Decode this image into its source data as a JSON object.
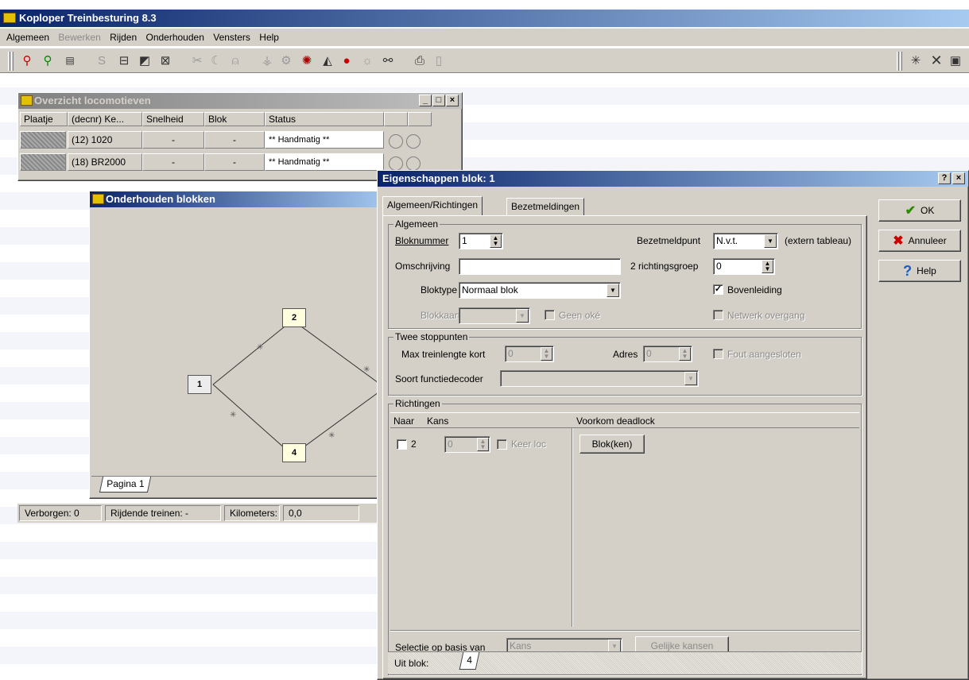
{
  "app": {
    "title": "Koploper Treinbesturing 8.3"
  },
  "menu": [
    {
      "label": "Algemeen",
      "disabled": false
    },
    {
      "label": "Bewerken",
      "disabled": true
    },
    {
      "label": "Rijden",
      "disabled": false
    },
    {
      "label": "Onderhouden",
      "disabled": false
    },
    {
      "label": "Vensters",
      "disabled": false
    },
    {
      "label": "Help",
      "disabled": false
    }
  ],
  "toolbar": {
    "icons": [
      "signal-red-icon",
      "signal-green-icon",
      "terminal-icon",
      "s-icon",
      "block-icon",
      "edit-block-icon",
      "delete-block-icon",
      "tools-icon",
      "curve-icon",
      "bell-icon",
      "switch-icon",
      "decoder-icon",
      "sound-icon",
      "locomotive-icon",
      "stop-icon",
      "light-icon",
      "track-icon",
      "print-icon",
      "page-icon"
    ],
    "right_icons": [
      "new-icon",
      "close-icon",
      "save-icon"
    ]
  },
  "loco_window": {
    "title": "Overzicht locomotieven",
    "columns": [
      "Plaatje",
      "(decnr) Ke...",
      "Snelheid",
      "Blok",
      "Status"
    ],
    "rows": [
      {
        "name": "(12) 1020",
        "speed": "-",
        "block": "-",
        "status": "** Handmatig **"
      },
      {
        "name": "(18) BR2000",
        "speed": "-",
        "block": "-",
        "status": "** Handmatig **"
      }
    ]
  },
  "blocks_window": {
    "title": "Onderhouden blokken",
    "page_tab": "Pagina 1",
    "blocks": [
      "1",
      "2",
      "4"
    ]
  },
  "statusbar": {
    "hidden": "Verborgen: 0",
    "driving": "Rijdende treinen: -",
    "km_label": "Kilometers:",
    "km_value": "0,0"
  },
  "dialog": {
    "title": "Eigenschappen blok: 1",
    "help_glyph": "?",
    "close_glyph": "×",
    "tabs": [
      "Algemeen/Richtingen",
      "Bezetmeldingen"
    ],
    "buttons": {
      "ok": "OK",
      "cancel": "Annuleer",
      "help": "Help"
    },
    "algemeen": {
      "group": "Algemeen",
      "bloknummer_label": "Bloknummer",
      "bloknummer_value": "1",
      "bezetmeldpunt_label": "Bezetmeldpunt",
      "bezetmeldpunt_value": "N.v.t.",
      "extern_label": "(extern tableau)",
      "omschrijving_label": "Omschrijving",
      "omschrijving_value": "",
      "richtingsgroep_label": "2 richtingsgroep",
      "richtingsgroep_value": "0",
      "bloktype_label": "Bloktype",
      "bloktype_value": "Normaal blok",
      "bovenleiding_label": "Bovenleiding",
      "bovenleiding_checked": true,
      "blokkaart_label": "Blokkaart",
      "geen_oke_label": "Geen oké",
      "netwerk_label": "Netwerk overgang"
    },
    "stoppunten": {
      "group": "Twee stoppunten",
      "max_label": "Max treinlengte kort",
      "max_value": "0",
      "adres_label": "Adres",
      "adres_value": "0",
      "fout_label": "Fout aangesloten",
      "decoder_label": "Soort functiedecoder",
      "decoder_value": ""
    },
    "richtingen": {
      "group": "Richtingen",
      "columns": [
        "Naar",
        "Kans",
        "Voorkom deadlock"
      ],
      "row": {
        "naar": "2",
        "kans": "0",
        "keer_label": "Keer loc",
        "blokken_button": "Blok(ken)"
      },
      "selectie_label": "Selectie op basis van",
      "selectie_value": "Kans",
      "gelijke_button": "Gelijke kansen",
      "uit_blok_label": "Uit blok:",
      "uit_blok_tab": "4"
    }
  }
}
